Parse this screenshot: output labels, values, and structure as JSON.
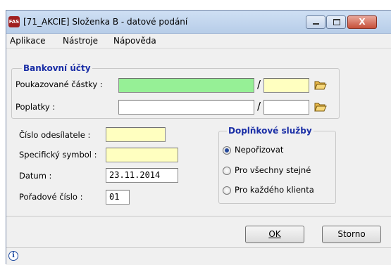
{
  "window": {
    "title": "[71_AKCIE] Složenka B - datové podání",
    "app_icon_text": "FAS",
    "close_glyph": "X"
  },
  "menu": {
    "items": [
      "Aplikace",
      "Nástroje",
      "Nápověda"
    ]
  },
  "bank_accounts": {
    "title": "Bankovní účty",
    "poukazovane_label": "Poukazované částky :",
    "poukazovane_value": "",
    "poukazovane_code": "",
    "poplatky_label": "Poplatky :",
    "poplatky_value": "",
    "poplatky_code": "",
    "separator": "/"
  },
  "fields": {
    "cislo_label": "Číslo odesílatele :",
    "cislo_value": "",
    "symbol_label": "Specifický symbol :",
    "symbol_value": "",
    "datum_label": "Datum :",
    "datum_value": "23.11.2014",
    "poradove_label": "Pořadové číslo :",
    "poradove_value": "01"
  },
  "services": {
    "title": "Doplňkové služby",
    "options": [
      {
        "label": "Nepořizovat",
        "checked": true
      },
      {
        "label": "Pro všechny stejné",
        "checked": false
      },
      {
        "label": "Pro každého klienta",
        "checked": false
      }
    ]
  },
  "buttons": {
    "ok_label": "OK",
    "storno_label": "Storno"
  },
  "colors": {
    "group_title": "#1a2ea6",
    "active_field": "#96f096",
    "required_field": "#ffffc0"
  }
}
